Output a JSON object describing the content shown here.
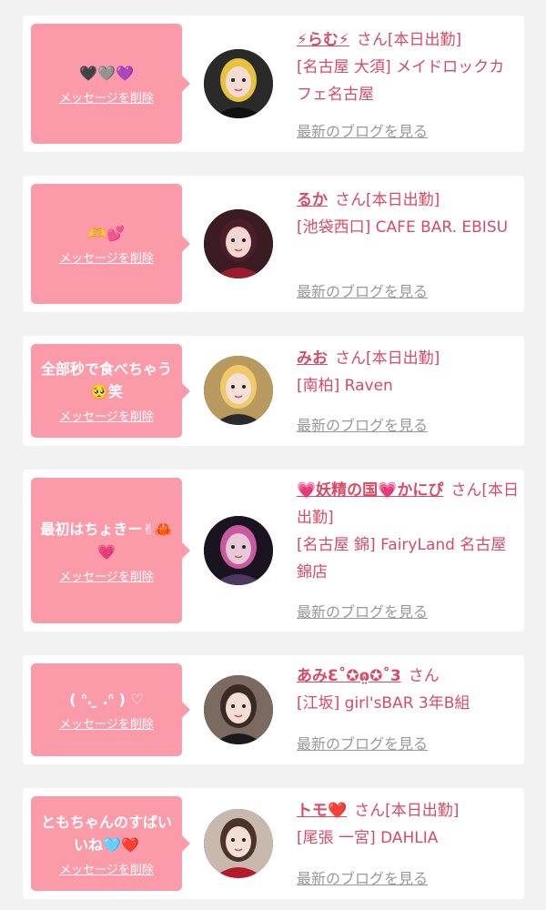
{
  "colors": {
    "page_bg": "#f2f2f2",
    "card_bg": "#ffffff",
    "bubble_bg": "#fb9aa8",
    "accent_text": "#d94a66",
    "blog_link": "#999999"
  },
  "items": [
    {
      "message": "🖤🩶💜",
      "delete_label": "メッセージを削除",
      "avatar": "cast-photo-icon",
      "name": "⚡らむ⚡",
      "san": "さん",
      "status": "[本日出勤]",
      "shop": "[名古屋 大須] メイドロックカフェ名古屋",
      "blog_label": "最新のブログを見る"
    },
    {
      "message": "🫶💕",
      "delete_label": "メッセージを削除",
      "avatar": "cast-photo-icon",
      "name": "るか",
      "san": "さん",
      "status": "[本日出勤]",
      "shop": "[池袋西口] CAFE BAR. EBISU",
      "blog_label": "最新のブログを見る"
    },
    {
      "message": "全部秒で食べちゃう🥺笑",
      "delete_label": "メッセージを削除",
      "avatar": "cast-photo-icon",
      "name": "みお",
      "san": "さん",
      "status": "[本日出勤]",
      "shop": "[南柏] Raven",
      "blog_label": "最新のブログを見る"
    },
    {
      "message": "最初はちょきー✌︎🦀💗",
      "delete_label": "メッセージを削除",
      "avatar": "cast-photo-icon",
      "name": "💗妖精の国💗かにぴ",
      "san": "さん",
      "status": "[本日出勤]",
      "shop": "[名古屋 錦] FairyLand 名古屋錦店",
      "blog_label": "最新のブログを見る"
    },
    {
      "message": "( ᐢ.  ̫ .ᐢ ) ♡",
      "delete_label": "メッセージを削除",
      "avatar": "cast-photo-icon",
      "name": "あみƐ˚✪ɷ̤✪˚3",
      "san": "さん",
      "status": "",
      "shop": "[江坂] girl'sBAR 3年B組",
      "blog_label": "最新のブログを見る"
    },
    {
      "message": "ともちゃんのすばいいね🩵❤️",
      "delete_label": "メッセージを削除",
      "avatar": "cast-photo-icon",
      "name": "トモ❤️",
      "san": "さん",
      "status": "[本日出勤]",
      "shop": "[尾張 一宮] DAHLIA",
      "blog_label": "最新のブログを見る"
    }
  ]
}
